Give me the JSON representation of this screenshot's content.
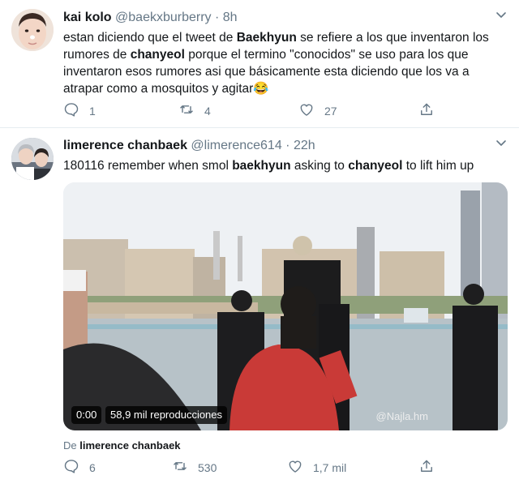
{
  "tweets": [
    {
      "author_name": "kai kolo",
      "author_handle": "@baekxburberry",
      "time": "8h",
      "text_parts": [
        {
          "t": "estan diciendo que el tweet de ",
          "bold": false
        },
        {
          "t": "Baekhyun",
          "bold": true
        },
        {
          "t": " se refiere a los que inventaron los rumores de ",
          "bold": false
        },
        {
          "t": "chanyeol",
          "bold": true
        },
        {
          "t": " porque el termino \"conocidos\" se uso para los que inventaron esos rumores asi que básicamente esta diciendo que los va a atrapar como a mosquitos y agitar",
          "bold": false
        },
        {
          "t": "😂",
          "bold": false
        }
      ],
      "actions": {
        "reply": "1",
        "retweet": "4",
        "like": "27"
      }
    },
    {
      "author_name": "limerence chanbaek",
      "author_handle": "@limerence614",
      "time": "22h",
      "text_parts": [
        {
          "t": "180116 remember when smol ",
          "bold": false
        },
        {
          "t": "baekhyun",
          "bold": true
        },
        {
          "t": " asking to ",
          "bold": false
        },
        {
          "t": "chanyeol",
          "bold": true
        },
        {
          "t": " to lift him up",
          "bold": false
        }
      ],
      "media": {
        "time": "0:00",
        "views": "58,9 mil reproducciones",
        "watermark": "@Najla.hm"
      },
      "from_label": "De",
      "from_name": "limerence chanbaek",
      "actions": {
        "reply": "6",
        "retweet": "530",
        "like": "1,7 mil"
      }
    }
  ],
  "separator": "·",
  "icons": {
    "reply": "reply-icon",
    "retweet": "retweet-icon",
    "like": "heart-icon",
    "share": "share-icon",
    "caret": "chevron-down-icon"
  },
  "colors": {
    "text": "#14171a",
    "muted": "#657786",
    "divider": "#e6ecf0"
  }
}
